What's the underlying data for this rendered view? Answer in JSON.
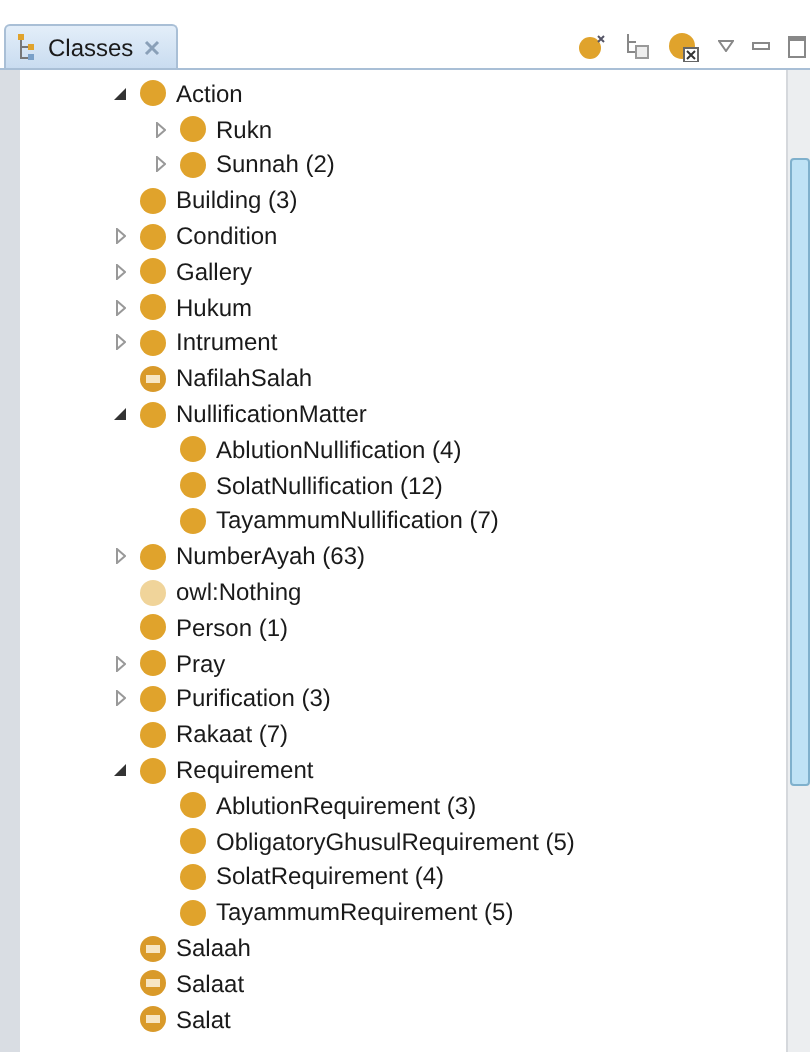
{
  "tab": {
    "label": "Classes",
    "selected": true
  },
  "tree": [
    {
      "label": "Action",
      "kind": "class",
      "expanded": true,
      "children": [
        {
          "label": "Rukn",
          "kind": "class",
          "expanded": false
        },
        {
          "label": "Sunnah (2)",
          "kind": "class",
          "expanded": false
        }
      ]
    },
    {
      "label": "Building (3)",
      "kind": "class"
    },
    {
      "label": "Condition",
      "kind": "class",
      "expanded": false
    },
    {
      "label": "Gallery",
      "kind": "class",
      "expanded": false
    },
    {
      "label": "Hukum",
      "kind": "class",
      "expanded": false
    },
    {
      "label": "Intrument",
      "kind": "class",
      "expanded": false
    },
    {
      "label": "NafilahSalah",
      "kind": "defined"
    },
    {
      "label": "NullificationMatter",
      "kind": "class",
      "expanded": true,
      "children": [
        {
          "label": "AblutionNullification (4)",
          "kind": "class"
        },
        {
          "label": "SolatNullification (12)",
          "kind": "class"
        },
        {
          "label": "TayammumNullification (7)",
          "kind": "class"
        }
      ]
    },
    {
      "label": "NumberAyah (63)",
      "kind": "class",
      "expanded": false
    },
    {
      "label": "owl:Nothing",
      "kind": "nothing"
    },
    {
      "label": "Person (1)",
      "kind": "class"
    },
    {
      "label": "Pray",
      "kind": "class",
      "expanded": false
    },
    {
      "label": "Purification (3)",
      "kind": "class",
      "expanded": false
    },
    {
      "label": "Rakaat (7)",
      "kind": "class"
    },
    {
      "label": "Requirement",
      "kind": "class",
      "expanded": true,
      "children": [
        {
          "label": "AblutionRequirement (3)",
          "kind": "class"
        },
        {
          "label": "ObligatoryGhusulRequirement (5)",
          "kind": "class"
        },
        {
          "label": "SolatRequirement (4)",
          "kind": "class"
        },
        {
          "label": "TayammumRequirement (5)",
          "kind": "class"
        }
      ]
    },
    {
      "label": "Salaah",
      "kind": "defined"
    },
    {
      "label": "Salaat",
      "kind": "defined"
    },
    {
      "label": "Salat",
      "kind": "defined"
    }
  ]
}
